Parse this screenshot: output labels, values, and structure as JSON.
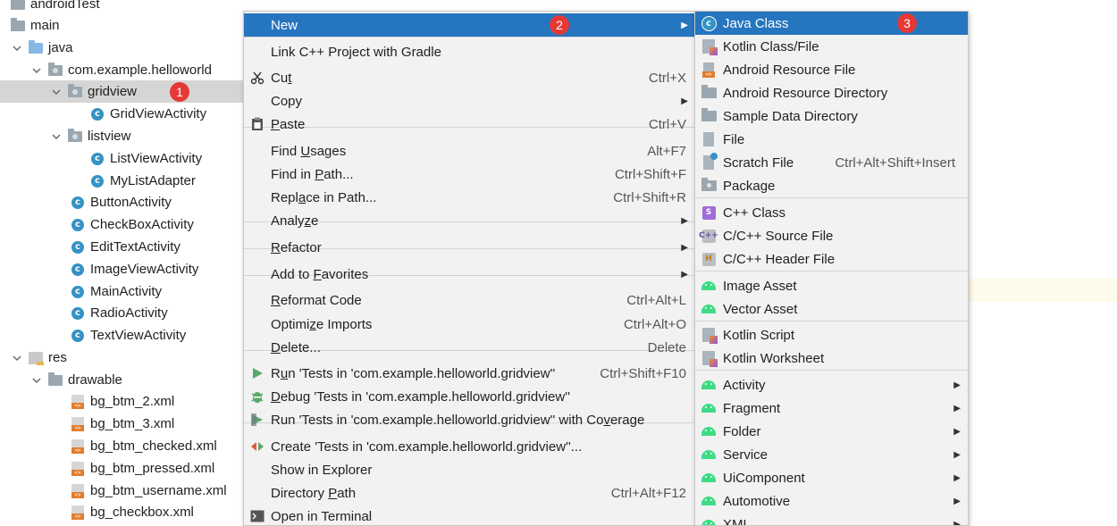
{
  "tree": {
    "rows": [
      {
        "label": "androidTest",
        "icon": "folder-icon"
      },
      {
        "label": "main",
        "icon": "folder-icon"
      },
      {
        "label": "java",
        "icon": "source-folder-icon"
      },
      {
        "label": "com.example.helloworld",
        "icon": "package-icon"
      },
      {
        "label": "gridview",
        "icon": "package-icon",
        "selected": true,
        "badge": "1"
      },
      {
        "label": "GridViewActivity",
        "icon": "class-icon"
      },
      {
        "label": "listview",
        "icon": "package-icon"
      },
      {
        "label": "ListViewActivity",
        "icon": "class-icon"
      },
      {
        "label": "MyListAdapter",
        "icon": "class-icon"
      },
      {
        "label": "ButtonActivity",
        "icon": "class-icon"
      },
      {
        "label": "CheckBoxActivity",
        "icon": "class-icon"
      },
      {
        "label": "EditTextActivity",
        "icon": "class-icon"
      },
      {
        "label": "ImageViewActivity",
        "icon": "class-icon"
      },
      {
        "label": "MainActivity",
        "icon": "class-icon"
      },
      {
        "label": "RadioActivity",
        "icon": "class-icon"
      },
      {
        "label": "TextViewActivity",
        "icon": "class-icon"
      },
      {
        "label": "res",
        "icon": "resource-folder-icon"
      },
      {
        "label": "drawable",
        "icon": "folder-icon"
      },
      {
        "label": "bg_btm_2.xml",
        "icon": "xml-file-icon"
      },
      {
        "label": "bg_btm_3.xml",
        "icon": "xml-file-icon"
      },
      {
        "label": "bg_btm_checked.xml",
        "icon": "xml-file-icon"
      },
      {
        "label": "bg_btm_pressed.xml",
        "icon": "xml-file-icon"
      },
      {
        "label": "bg_btm_username.xml",
        "icon": "xml-file-icon"
      },
      {
        "label": "bg_checkbox.xml",
        "icon": "xml-file-icon"
      }
    ]
  },
  "context_menu": {
    "items": [
      {
        "pre": "",
        "u": "",
        "post": "New",
        "shortcut": "",
        "submenu": true,
        "badge": "2",
        "icon": ""
      },
      {
        "pre": "Link C++ Project with Gradle",
        "u": "",
        "post": "",
        "shortcut": "",
        "icon": ""
      },
      {
        "pre": "Cu",
        "u": "t",
        "post": "",
        "shortcut": "Ctrl+X",
        "icon": "scissors-icon"
      },
      {
        "pre": "Copy",
        "u": "",
        "post": "",
        "shortcut": "",
        "submenu": true,
        "icon": ""
      },
      {
        "pre": "",
        "u": "P",
        "post": "aste",
        "shortcut": "Ctrl+V",
        "icon": "clipboard-icon"
      },
      {
        "pre": "Find ",
        "u": "U",
        "post": "sages",
        "shortcut": "Alt+F7",
        "icon": ""
      },
      {
        "pre": "Find in ",
        "u": "P",
        "post": "ath...",
        "shortcut": "Ctrl+Shift+F",
        "icon": ""
      },
      {
        "pre": "Repl",
        "u": "a",
        "post": "ce in Path...",
        "shortcut": "Ctrl+Shift+R",
        "icon": ""
      },
      {
        "pre": "Analy",
        "u": "z",
        "post": "e",
        "shortcut": "",
        "submenu": true,
        "icon": ""
      },
      {
        "pre": "",
        "u": "R",
        "post": "efactor",
        "shortcut": "",
        "submenu": true,
        "icon": ""
      },
      {
        "pre": "Add to ",
        "u": "F",
        "post": "avorites",
        "shortcut": "",
        "submenu": true,
        "icon": ""
      },
      {
        "pre": "",
        "u": "R",
        "post": "eformat Code",
        "shortcut": "Ctrl+Alt+L",
        "icon": ""
      },
      {
        "pre": "Optimi",
        "u": "z",
        "post": "e Imports",
        "shortcut": "Ctrl+Alt+O",
        "icon": ""
      },
      {
        "pre": "",
        "u": "D",
        "post": "elete...",
        "shortcut": "Delete",
        "icon": ""
      },
      {
        "pre": "R",
        "u": "u",
        "post": "n 'Tests in 'com.example.helloworld.gridview''",
        "shortcut": "Ctrl+Shift+F10",
        "icon": "run-icon"
      },
      {
        "pre": "",
        "u": "D",
        "post": "ebug 'Tests in 'com.example.helloworld.gridview''",
        "shortcut": "",
        "icon": "debug-icon"
      },
      {
        "pre": "Run 'Tests in 'com.example.helloworld.gridview'' with Co",
        "u": "v",
        "post": "erage",
        "shortcut": "",
        "icon": "coverage-icon"
      },
      {
        "pre": "Create 'Tests in 'com.example.helloworld.gridview''...",
        "u": "",
        "post": "",
        "shortcut": "",
        "icon": "create-test-icon"
      },
      {
        "pre": "Show in Explorer",
        "u": "",
        "post": "",
        "shortcut": "",
        "icon": ""
      },
      {
        "pre": "Directory ",
        "u": "P",
        "post": "ath",
        "shortcut": "Ctrl+Alt+F12",
        "icon": ""
      },
      {
        "pre": "Open in Terminal",
        "u": "",
        "post": "",
        "shortcut": "",
        "icon": "terminal-icon"
      }
    ]
  },
  "new_submenu": {
    "items": [
      {
        "label": "Java Class",
        "shortcut": "",
        "icon": "java-class-icon",
        "badge": "3"
      },
      {
        "label": "Kotlin Class/File",
        "shortcut": "",
        "icon": "kotlin-file-icon"
      },
      {
        "label": "Android Resource File",
        "shortcut": "",
        "icon": "android-resource-file-icon"
      },
      {
        "label": "Android Resource Directory",
        "shortcut": "",
        "icon": "folder-icon"
      },
      {
        "label": "Sample Data Directory",
        "shortcut": "",
        "icon": "folder-icon"
      },
      {
        "label": "File",
        "shortcut": "",
        "icon": "file-icon"
      },
      {
        "label": "Scratch File",
        "shortcut": "Ctrl+Alt+Shift+Insert",
        "icon": "scratch-file-icon"
      },
      {
        "label": "Package",
        "shortcut": "",
        "icon": "package-icon"
      },
      {
        "label": "C++ Class",
        "shortcut": "",
        "icon": "cpp-class-icon"
      },
      {
        "label": "C/C++ Source File",
        "shortcut": "",
        "icon": "cpp-source-icon"
      },
      {
        "label": "C/C++ Header File",
        "shortcut": "",
        "icon": "cpp-header-icon"
      },
      {
        "label": "Image Asset",
        "shortcut": "",
        "icon": "android-icon"
      },
      {
        "label": "Vector Asset",
        "shortcut": "",
        "icon": "android-icon"
      },
      {
        "label": "Kotlin Script",
        "shortcut": "",
        "icon": "kotlin-script-icon"
      },
      {
        "label": "Kotlin Worksheet",
        "shortcut": "",
        "icon": "kotlin-worksheet-icon"
      },
      {
        "label": "Activity",
        "shortcut": "",
        "icon": "android-icon",
        "submenu": true
      },
      {
        "label": "Fragment",
        "shortcut": "",
        "icon": "android-icon",
        "submenu": true
      },
      {
        "label": "Folder",
        "shortcut": "",
        "icon": "android-icon",
        "submenu": true
      },
      {
        "label": "Service",
        "shortcut": "",
        "icon": "android-icon",
        "submenu": true
      },
      {
        "label": "UiComponent",
        "shortcut": "",
        "icon": "android-icon",
        "submenu": true
      },
      {
        "label": "Automotive",
        "shortcut": "",
        "icon": "android-icon",
        "submenu": true
      },
      {
        "label": "XML",
        "shortcut": "",
        "icon": "android-icon",
        "submenu": true
      }
    ]
  },
  "colors": {
    "highlight": "#2675bf",
    "badge": "#e53935",
    "selection": "#d5d5d5"
  }
}
